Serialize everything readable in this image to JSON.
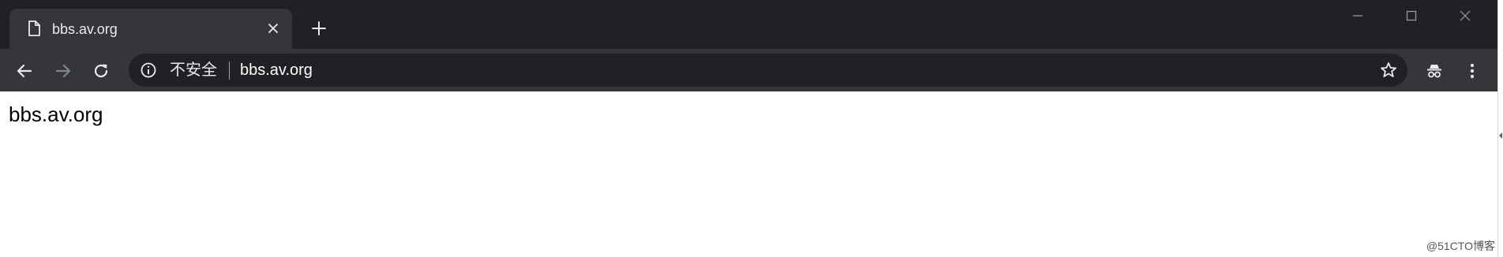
{
  "tab": {
    "title": "bbs.av.org",
    "favicon_icon": "page-icon",
    "close_icon": "close-icon"
  },
  "new_tab_icon": "plus-icon",
  "window_controls": [
    "minimize-icon",
    "maximize-icon",
    "close-icon"
  ],
  "toolbar": {
    "back_icon": "arrow-left-icon",
    "forward_icon": "arrow-right-icon",
    "reload_icon": "reload-icon",
    "bookmark_icon": "star-icon",
    "incognito_icon": "incognito-icon",
    "menu_icon": "kebab-menu-icon"
  },
  "omnibox": {
    "security_label": "不安全",
    "url": "bbs.av.org"
  },
  "page": {
    "text": "bbs.av.org"
  },
  "watermark": "@51CTO博客",
  "colors": {
    "tabstrip_bg": "#202124",
    "toolbar_bg": "#35363a",
    "omnibox_bg": "#202124",
    "text_light": "#e8eaed",
    "forward_disabled": "#9aa0a6"
  }
}
